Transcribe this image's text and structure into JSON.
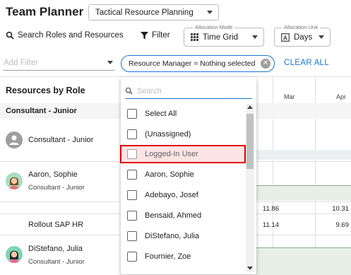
{
  "header": {
    "title": "Team Planner",
    "view_select": "Tactical Resource Planning"
  },
  "toolbar": {
    "search_label": "Search Roles and Resources",
    "filter_label": "Filter",
    "allocation_mode": {
      "legend": "Allocation Mode",
      "value": "Time Grid"
    },
    "allocation_unit": {
      "legend": "Allocation Unit",
      "value": "Days"
    }
  },
  "filter_bar": {
    "add_filter_placeholder": "Add Filter",
    "chip_text": "Resource Manager = Nothing selected",
    "clear_all": "CLEAR ALL"
  },
  "grid": {
    "left_header": "Resources by Role",
    "months": [
      "Mar",
      "Apr"
    ],
    "group": "Consultant - Junior",
    "rows": [
      {
        "name": "Consultant - Junior",
        "role": ""
      },
      {
        "name": "Aaron, Sophie",
        "role": "Consultant - Junior",
        "values": [
          "11.86",
          "10.31"
        ]
      },
      {
        "name": "Rollout SAP HR",
        "role": "",
        "values": [
          "11.14",
          "9.69"
        ]
      },
      {
        "name": "DiStefano, Julia",
        "role": "Consultant - Junior"
      }
    ]
  },
  "dropdown": {
    "search_placeholder": "Search",
    "options": [
      "Select All",
      "(Unassigned)",
      "Logged-In User",
      "Aaron, Sophie",
      "Adebayo, Josef",
      "Bensaid, Ahmed",
      "DiStefano, Julia",
      "Fournier, Zoe"
    ],
    "highlighted": "Logged-In User"
  },
  "colors": {
    "accent": "#1976d2",
    "highlight_border": "#e00000",
    "allocation_fill": "#e8f0e5"
  }
}
